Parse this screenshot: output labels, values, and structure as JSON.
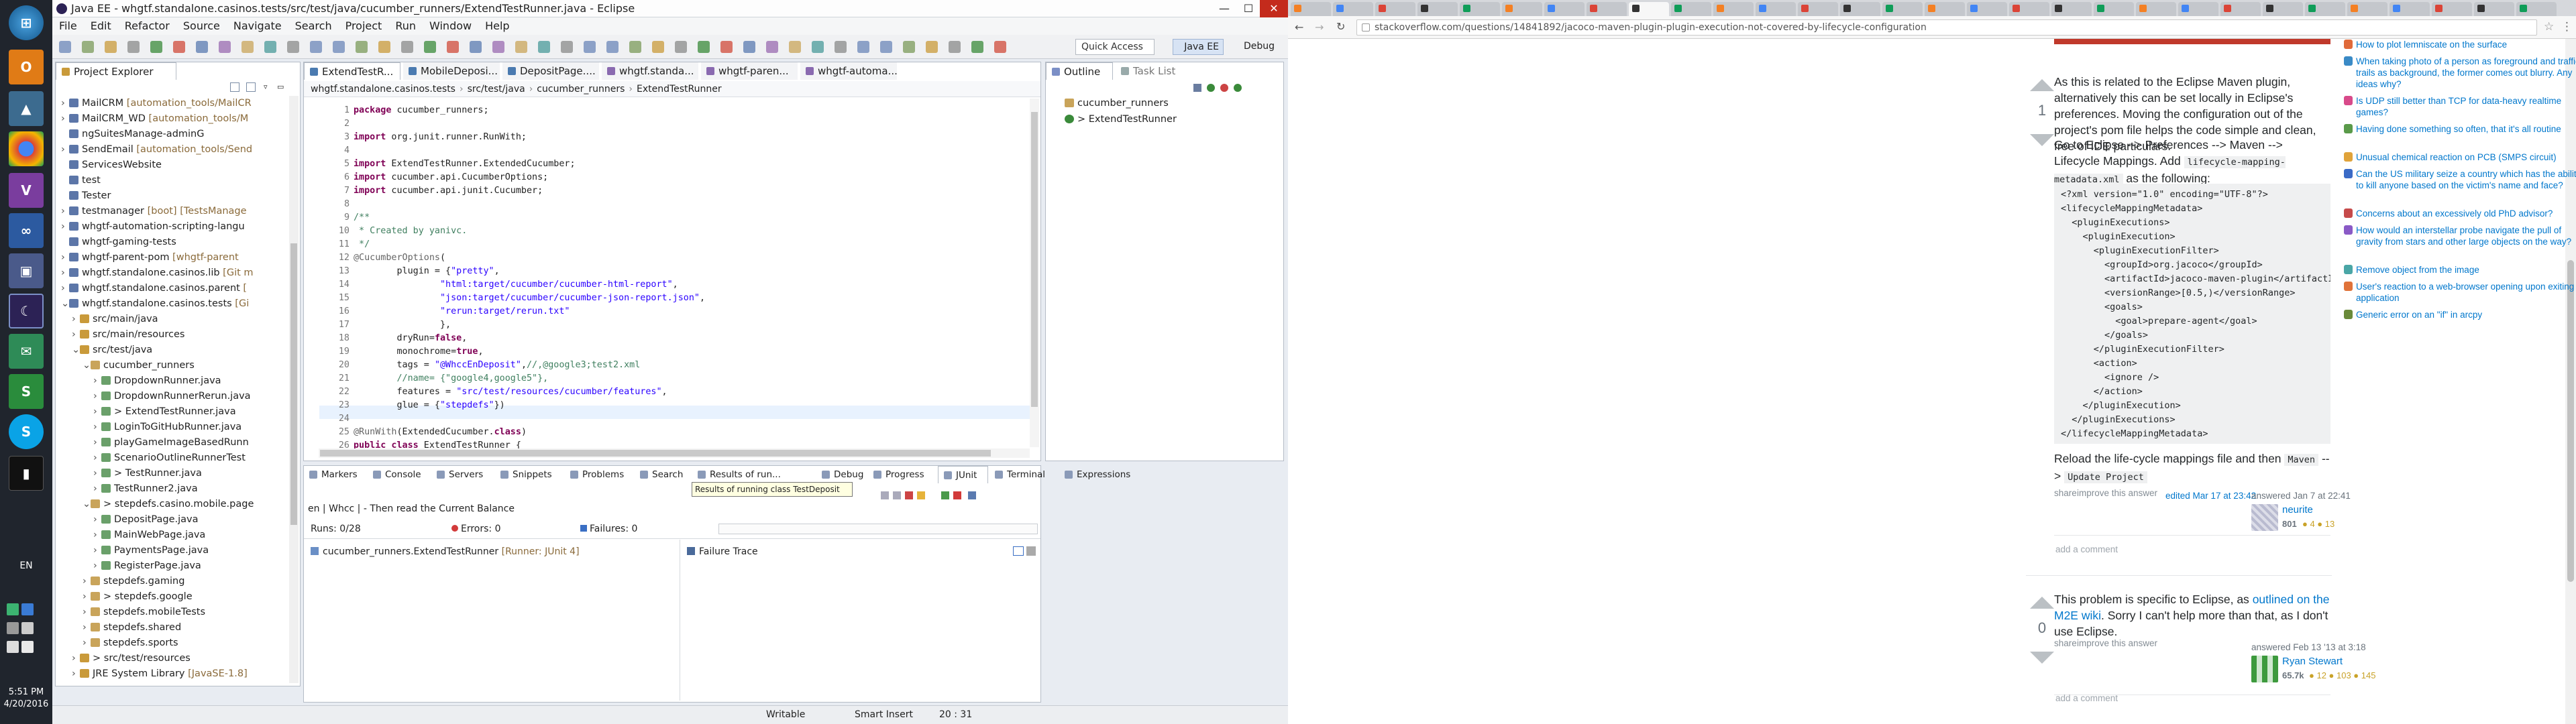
{
  "taskbar": {
    "language": "EN",
    "time": "5:51 PM",
    "date": "4/20/2016"
  },
  "eclipse": {
    "title": "Java EE - whgtf.standalone.casinos.tests/src/test/java/cucumber_runners/ExtendTestRunner.java - Eclipse",
    "menu": [
      "File",
      "Edit",
      "Refactor",
      "Source",
      "Navigate",
      "Search",
      "Project",
      "Run",
      "Window",
      "Help"
    ],
    "quick_access": "Quick Access",
    "perspective_javaee": "Java EE",
    "perspective_debug": "Debug",
    "project_explorer": {
      "tab": "Project Explorer",
      "items": [
        {
          "label": "MailCRM",
          "deco": " [automation_tools/MailCR",
          "indent": 0,
          "arrow": "›"
        },
        {
          "label": "MailCRM_WD",
          "deco": " [automation_tools/M",
          "indent": 0,
          "arrow": "›"
        },
        {
          "label": "ngSuitesManage-adminG",
          "deco": "",
          "indent": 0,
          "arrow": ""
        },
        {
          "label": "SendEmail",
          "deco": " [automation_tools/Send",
          "indent": 0,
          "arrow": "›"
        },
        {
          "label": "ServicesWebsite",
          "deco": "",
          "indent": 0,
          "arrow": ""
        },
        {
          "label": "test",
          "deco": "",
          "indent": 0,
          "arrow": ""
        },
        {
          "label": "Tester",
          "deco": "",
          "indent": 0,
          "arrow": ""
        },
        {
          "label": "testmanager",
          "deco": " [boot] [TestsManage",
          "indent": 0,
          "arrow": "›"
        },
        {
          "label": "whgtf-automation-scripting-langu",
          "deco": "",
          "indent": 0,
          "arrow": "›"
        },
        {
          "label": "whgtf-gaming-tests",
          "deco": "",
          "indent": 0,
          "arrow": ""
        },
        {
          "label": "whgtf-parent-pom",
          "deco": " [whgtf-parent",
          "indent": 0,
          "arrow": "›"
        },
        {
          "label": "whgtf.standalone.casinos.lib",
          "deco": " [Git m",
          "indent": 0,
          "arrow": "›"
        },
        {
          "label": "whgtf.standalone.casinos.parent",
          "deco": " [",
          "indent": 0,
          "arrow": "›"
        },
        {
          "label": "whgtf.standalone.casinos.tests",
          "deco": " [Gi",
          "indent": 0,
          "arrow": "⌄"
        },
        {
          "label": "src/main/java",
          "deco": "",
          "indent": 1,
          "arrow": "›"
        },
        {
          "label": "src/main/resources",
          "deco": "",
          "indent": 1,
          "arrow": "›"
        },
        {
          "label": "src/test/java",
          "deco": "",
          "indent": 1,
          "arrow": "⌄"
        },
        {
          "label": "cucumber_runners",
          "deco": "",
          "indent": 2,
          "arrow": "⌄"
        },
        {
          "label": "DropdownRunner.java",
          "deco": "",
          "indent": 3,
          "arrow": "›"
        },
        {
          "label": "DropdownRunnerRerun.java",
          "deco": "",
          "indent": 3,
          "arrow": "›"
        },
        {
          "label": "> ExtendTestRunner.java",
          "deco": "",
          "indent": 3,
          "arrow": "›"
        },
        {
          "label": "LoginToGitHubRunner.java",
          "deco": "",
          "indent": 3,
          "arrow": "›"
        },
        {
          "label": "playGameImageBasedRunn",
          "deco": "",
          "indent": 3,
          "arrow": "›"
        },
        {
          "label": "ScenarioOutlineRunnerTest",
          "deco": "",
          "indent": 3,
          "arrow": "›"
        },
        {
          "label": "> TestRunner.java",
          "deco": "",
          "indent": 3,
          "arrow": "›"
        },
        {
          "label": "TestRunner2.java",
          "deco": "",
          "indent": 3,
          "arrow": "›"
        },
        {
          "label": "> stepdefs.casino.mobile.page",
          "deco": "",
          "indent": 2,
          "arrow": "⌄"
        },
        {
          "label": "DepositPage.java",
          "deco": "",
          "indent": 3,
          "arrow": "›"
        },
        {
          "label": "MainWebPage.java",
          "deco": "",
          "indent": 3,
          "arrow": "›"
        },
        {
          "label": "PaymentsPage.java",
          "deco": "",
          "indent": 3,
          "arrow": "›"
        },
        {
          "label": "RegisterPage.java",
          "deco": "",
          "indent": 3,
          "arrow": "›"
        },
        {
          "label": "stepdefs.gaming",
          "deco": "",
          "indent": 2,
          "arrow": "›"
        },
        {
          "label": "> stepdefs.google",
          "deco": "",
          "indent": 2,
          "arrow": "›"
        },
        {
          "label": "stepdefs.mobileTests",
          "deco": "",
          "indent": 2,
          "arrow": "›"
        },
        {
          "label": "stepdefs.shared",
          "deco": "",
          "indent": 2,
          "arrow": "›"
        },
        {
          "label": "stepdefs.sports",
          "deco": "",
          "indent": 2,
          "arrow": "›"
        },
        {
          "label": "> src/test/resources",
          "deco": "",
          "indent": 1,
          "arrow": "›"
        },
        {
          "label": "JRE System Library",
          "deco": " [JavaSE-1.8]",
          "indent": 1,
          "arrow": "›"
        }
      ]
    },
    "editor_tabs": [
      "ExtendTestR...",
      "MobileDeposi...",
      "DepositPage....",
      "whgtf.standa...",
      "whgtf-paren...",
      "whgtf-automa..."
    ],
    "breadcrumb": [
      "whgtf.standalone.casinos.tests",
      "src/test/java",
      "cucumber_runners",
      "ExtendTestRunner"
    ],
    "code_lines": [
      {
        "n": "1",
        "html": "<span class='kw'>package</span> cucumber_runners;"
      },
      {
        "n": "2",
        "html": ""
      },
      {
        "n": "3",
        "html": "<span class='kw'>import</span> org.junit.runner.RunWith;"
      },
      {
        "n": "4",
        "html": ""
      },
      {
        "n": "5",
        "html": "<span class='kw'>import</span> ExtendTestRunner.ExtendedCucumber;"
      },
      {
        "n": "6",
        "html": "<span class='kw'>import</span> cucumber.api.CucumberOptions;"
      },
      {
        "n": "7",
        "html": "<span class='kw'>import</span> cucumber.api.junit.Cucumber;"
      },
      {
        "n": "8",
        "html": ""
      },
      {
        "n": "9",
        "html": "<span class='com'>/**</span>"
      },
      {
        "n": "10",
        "html": "<span class='com'> * Created by yanivc.</span>"
      },
      {
        "n": "11",
        "html": "<span class='com'> */</span>"
      },
      {
        "n": "12",
        "html": "<span class='ann'>@CucumberOptions</span>("
      },
      {
        "n": "13",
        "html": "        plugin = {<span class='str'>\"pretty\"</span>,"
      },
      {
        "n": "14",
        "html": "                <span class='str'>\"html:target/cucumber/cucumber-html-report\"</span>,"
      },
      {
        "n": "15",
        "html": "                <span class='str'>\"json:target/cucumber/cucumber-json-report.json\"</span>,"
      },
      {
        "n": "16",
        "html": "                <span class='str'>\"rerun:target/rerun.txt\"</span>"
      },
      {
        "n": "17",
        "html": "                },"
      },
      {
        "n": "18",
        "html": "        dryRun=<span class='kw'>false</span>,"
      },
      {
        "n": "19",
        "html": "        monochrome=<span class='kw'>true</span>,"
      },
      {
        "n": "20",
        "html": "        tags = <span class='str'>\"@WhccEnDeposit\"</span>,<span class='com'>//,@google3;test2.xml</span>"
      },
      {
        "n": "21",
        "html": "        <span class='com'>//name= {\"google4,google5\"},</span>"
      },
      {
        "n": "22",
        "html": "        features = <span class='str'>\"src/test/resources/cucumber/features\"</span>,"
      },
      {
        "n": "23",
        "html": "        glue = {<span class='str'>\"stepdefs\"</span>})"
      },
      {
        "n": "24",
        "html": ""
      },
      {
        "n": "25",
        "html": "<span class='ann'>@RunWith</span>(ExtendedCucumber.<span class='kw'>class</span>)"
      },
      {
        "n": "26",
        "html": "<span class='kw'>public class</span> ExtendTestRunner {"
      }
    ],
    "outline": {
      "tab": "Outline",
      "tab2": "Task List",
      "items": [
        "cucumber_runners",
        "> ExtendTestRunner"
      ]
    },
    "bottom_tabs": [
      "Markers",
      "Console",
      "Servers",
      "Snippets",
      "Problems",
      "Search",
      "Results of run...",
      "Debug",
      "Progress",
      "JUnit",
      "Terminal",
      "Expressions"
    ],
    "tooltip": "Results of running class TestDeposit",
    "junit": {
      "header": "en | Whcc | - Then read the Current Balance",
      "runs": "Runs:  0/28",
      "errors": "Errors:  0",
      "failures": "Failures:  0",
      "root": "cucumber_runners.ExtendTestRunner",
      "root_deco": " [Runner: JUnit 4]",
      "failure_trace": "Failure Trace"
    },
    "status": {
      "writable": "Writable",
      "insert": "Smart Insert",
      "position": "20 : 31"
    }
  },
  "browser": {
    "url": "stackoverflow.com/questions/14841892/jacoco-maven-plugin-plugin-execution-not-covered-by-lifecycle-configuration",
    "answer1": {
      "votes": "1",
      "p1": "As this is related to the Eclipse Maven plugin, alternatively this can be set locally in Eclipse's preferences. Moving the configuration out of the project's pom file helps the code simple and clean, free of IDE particulars.",
      "p2_prefix": "Go to Eclipse --> Preferences --> Maven --> Lifecycle Mappings. Add",
      "p2_code": "lifecycle-mapping-metadata.xml",
      "p2_suffix": "as the following:",
      "code": "<?xml version=\"1.0\" encoding=\"UTF-8\"?>\n<lifecycleMappingMetadata>\n  <pluginExecutions>\n    <pluginExecution>\n      <pluginExecutionFilter>\n        <groupId>org.jacoco</groupId>\n        <artifactId>jacoco-maven-plugin</artifactId>\n        <versionRange>[0.5,)</versionRange>\n        <goals>\n          <goal>prepare-agent</goal>\n        </goals>\n      </pluginExecutionFilter>\n      <action>\n        <ignore />\n      </action>\n    </pluginExecution>\n  </pluginExecutions>\n</lifecycleMappingMetadata>",
      "p3_prefix": "Reload the life-cycle mappings file and then",
      "p3_code1": "Maven",
      "p3_arrow": "-->",
      "p3_code2": "Update Project",
      "share": "share",
      "improve": "improve this answer",
      "edited": "edited Mar 17 at 23:42",
      "answered": "answered Jan 7 at 22:41",
      "user": "neurite",
      "rep": "801",
      "badges": "● 4  ● 13",
      "add_comment": "add a comment"
    },
    "answer2": {
      "votes": "0",
      "p1_prefix": "This problem is specific to Eclipse, as",
      "p1_link": "outlined on the M2E wiki",
      "p1_suffix": ". Sorry I can't help more than that, as I don't use Eclipse.",
      "share": "share",
      "improve": "improve this answer",
      "answered": "answered Feb 13 '13 at 3:18",
      "user": "Ryan Stewart",
      "rep": "65.7k",
      "badges": "● 12  ● 103  ● 145",
      "add_comment": "add a comment"
    },
    "hot_questions": [
      "How to plot lemniscate on the surface",
      "When taking photo of a person as foreground and traffic trails as background, the former comes out blurry. Any ideas why?",
      "Is UDP still better than TCP for data-heavy realtime games?",
      "Having done something so often, that it's all routine",
      "Unusual chemical reaction on PCB (SMPS circuit)",
      "Can the US military seize a country which has the ability to kill anyone based on the victim's name and face?",
      "Concerns about an excessively old PhD advisor?",
      "How would an interstellar probe navigate the pull of gravity from stars and other large objects on the way?",
      "Remove object from the image",
      "User's reaction to a web-browser opening upon exiting application",
      "Generic error on an \"if\" in arcpy"
    ]
  },
  "colors": {
    "taskbar": "#20252d",
    "eclipse_bg": "#e8ecf2",
    "so_link": "#0077cc",
    "code_bg": "#eff0f1"
  }
}
